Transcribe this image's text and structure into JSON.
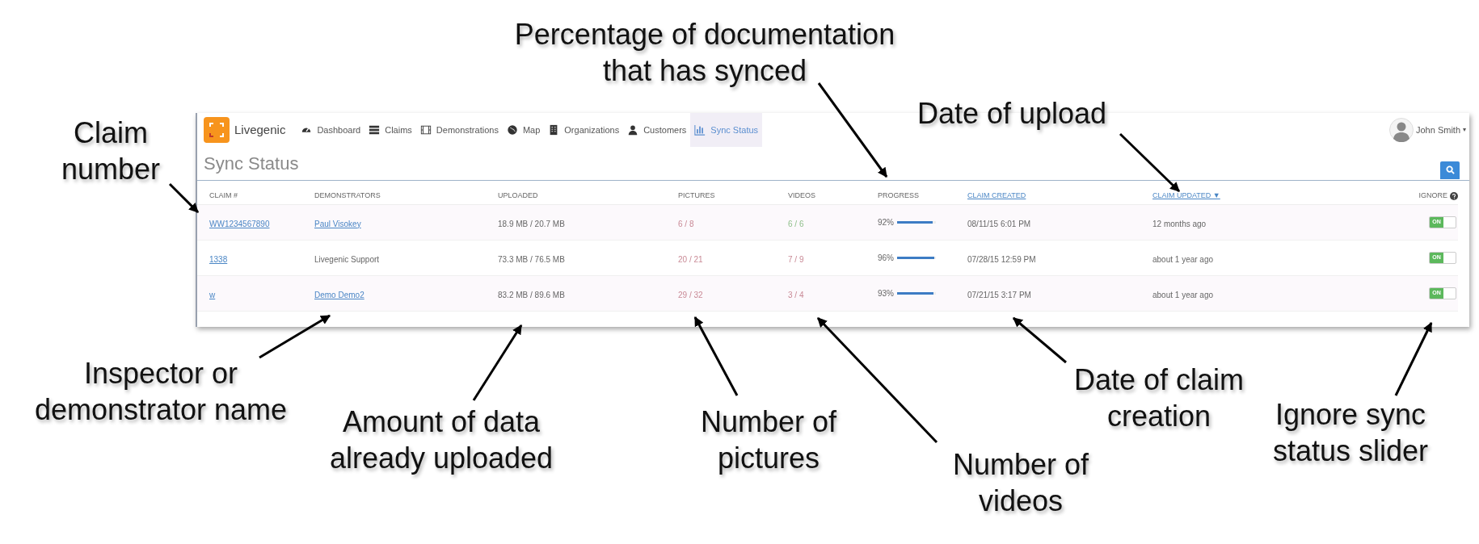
{
  "app": {
    "name": "Livegenic"
  },
  "nav": [
    {
      "label": "Dashboard",
      "selected": false
    },
    {
      "label": "Claims",
      "selected": false
    },
    {
      "label": "Demonstrations",
      "selected": false
    },
    {
      "label": "Map",
      "selected": false
    },
    {
      "label": "Organizations",
      "selected": false
    },
    {
      "label": "Customers",
      "selected": false
    },
    {
      "label": "Sync Status",
      "selected": true
    }
  ],
  "user": {
    "name": "John Smith",
    "caret": "▾"
  },
  "page_title": "Sync Status",
  "table": {
    "columns": [
      {
        "label": "CLAIM #",
        "sortable": false
      },
      {
        "label": "DEMONSTRATORS",
        "sortable": false
      },
      {
        "label": "UPLOADED",
        "sortable": false
      },
      {
        "label": "PICTURES",
        "sortable": false
      },
      {
        "label": "VIDEOS",
        "sortable": false
      },
      {
        "label": "PROGRESS",
        "sortable": false
      },
      {
        "label": "CLAIM CREATED",
        "sortable": true
      },
      {
        "label": "CLAIM UPDATED ▼",
        "sortable": true
      },
      {
        "label": "IGNORE",
        "sortable": false,
        "help": true
      }
    ],
    "rows": [
      {
        "claim": "WW1234567890",
        "demonstrator": "Paul Visokey",
        "demonstrator_link": true,
        "uploaded": "18.9 MB / 20.7 MB",
        "pictures": {
          "text": "6 / 8",
          "color": "#c98a96"
        },
        "videos": {
          "text": "6 / 6",
          "color": "#8fbf8a"
        },
        "progress": "92%",
        "level": 0.92,
        "created": "08/11/15 6:01 PM",
        "updated": "12 months ago",
        "ignore": {
          "label": "ON",
          "on": true
        }
      },
      {
        "claim": "1338",
        "demonstrator": "Livegenic Support",
        "demonstrator_link": false,
        "uploaded": "73.3 MB / 76.5 MB",
        "pictures": {
          "text": "20 / 21",
          "color": "#c98a96"
        },
        "videos": {
          "text": "7 / 9",
          "color": "#c98a96"
        },
        "progress": "96%",
        "level": 0.96,
        "created": "07/28/15 12:59 PM",
        "updated": "about 1 year ago",
        "ignore": {
          "label": "ON",
          "on": true
        }
      },
      {
        "claim": "w",
        "demonstrator": "Demo Demo2",
        "demonstrator_link": true,
        "uploaded": "83.2 MB / 89.6 MB",
        "pictures": {
          "text": "29 / 32",
          "color": "#c98a96"
        },
        "videos": {
          "text": "3 / 4",
          "color": "#c98a96"
        },
        "progress": "93%",
        "level": 0.93,
        "created": "07/21/15 3:17 PM",
        "updated": "about 1 year ago",
        "ignore": {
          "label": "ON",
          "on": true
        }
      }
    ]
  },
  "annotations": [
    {
      "lines": [
        "Percentage of documentation",
        "that has synced"
      ]
    },
    {
      "lines": [
        "Claim",
        "number"
      ]
    },
    {
      "lines": [
        "Date of upload"
      ]
    },
    {
      "lines": [
        "Inspector or",
        "demonstrator name"
      ]
    },
    {
      "lines": [
        "Amount of data",
        "already uploaded"
      ]
    },
    {
      "lines": [
        "Number of",
        "pictures"
      ]
    },
    {
      "lines": [
        "Date of claim",
        "creation"
      ]
    },
    {
      "lines": [
        "Number of",
        "videos"
      ]
    },
    {
      "lines": [
        "Ignore sync",
        "status slider"
      ]
    }
  ]
}
